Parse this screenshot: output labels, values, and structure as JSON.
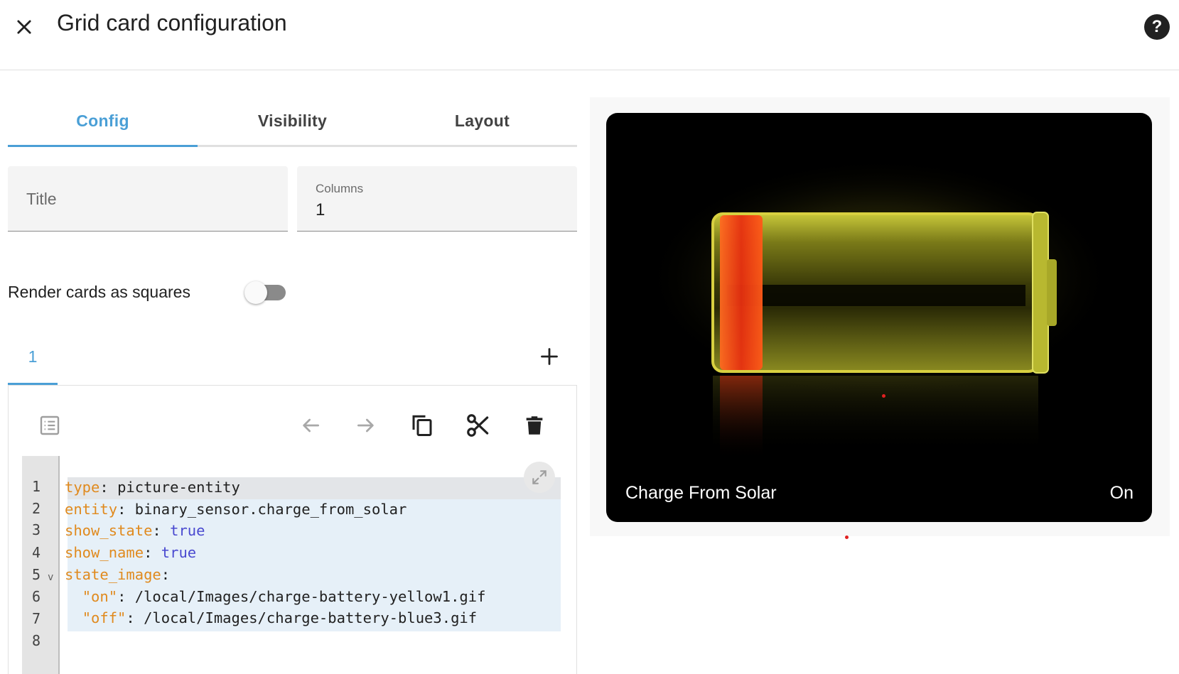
{
  "dialog": {
    "title": "Grid card configuration"
  },
  "tabs": [
    {
      "label": "Config",
      "active": true
    },
    {
      "label": "Visibility",
      "active": false
    },
    {
      "label": "Layout",
      "active": false
    }
  ],
  "fields": {
    "title_placeholder": "Title",
    "columns_label": "Columns",
    "columns_value": "1"
  },
  "toggle": {
    "label": "Render cards as squares",
    "on": false
  },
  "card_tabs": {
    "selected": "1"
  },
  "editor": {
    "line_numbers": [
      "1",
      "2",
      "3",
      "4",
      "5",
      "6",
      "7",
      "8"
    ],
    "lines": [
      {
        "key": "type",
        "value": "picture-entity"
      },
      {
        "key": "entity",
        "value": "binary_sensor.charge_from_solar"
      },
      {
        "key": "show_state",
        "value": "true"
      },
      {
        "key": "show_name",
        "value": "true"
      },
      {
        "key": "state_image",
        "value": ""
      },
      {
        "key": "\"on\"",
        "value": "/local/Images/charge-battery-yellow1.gif"
      },
      {
        "key": "\"off\"",
        "value": "/local/Images/charge-battery-blue3.gif"
      }
    ]
  },
  "preview": {
    "name": "Charge From Solar",
    "state": "On"
  },
  "colors": {
    "accent": "#4a9fd6",
    "yaml_key": "#e08a1e",
    "yaml_bool": "#4a4ad0",
    "battery_glow": "#d8d030",
    "battery_charge": "#ff3a10"
  },
  "icons": {
    "close": "close-icon",
    "help": "help-circle-icon",
    "add": "plus-icon",
    "visual_editor": "list-box-icon",
    "undo": "arrow-left-icon",
    "redo": "arrow-right-icon",
    "copy": "copy-icon",
    "cut": "scissors-icon",
    "delete": "trash-icon",
    "expand": "expand-icon"
  }
}
